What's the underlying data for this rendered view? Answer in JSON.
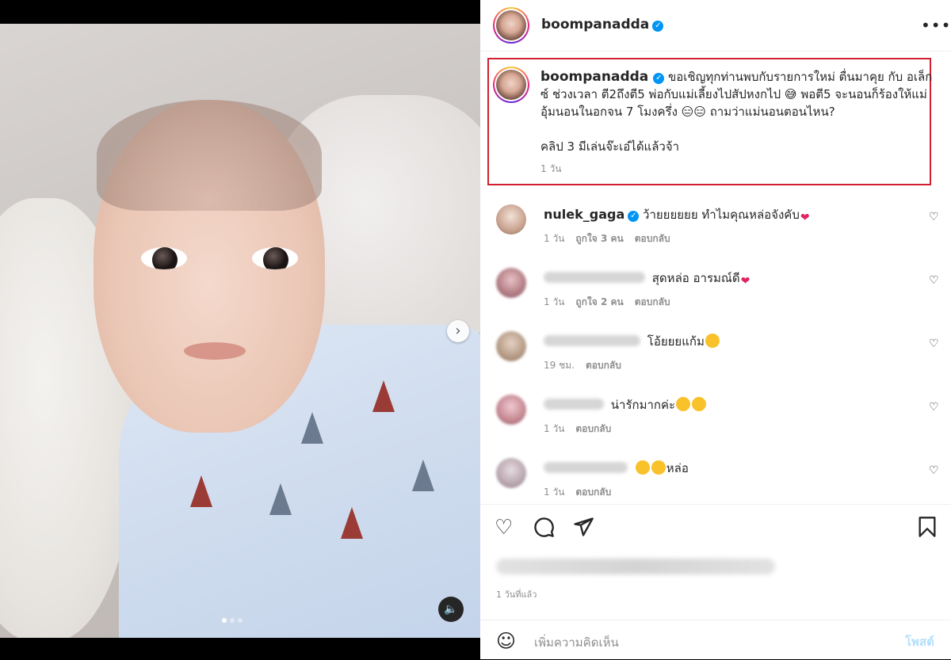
{
  "post": {
    "author": "boompanadda",
    "caption": "ขอเชิญทุกท่านพบกับรายการใหม่ ตื่นมาคุย กับ อเล็กซ์ ช่วงเวลา ตี2ถึงตี5 พ่อกับแม่เลี้ยงไปสัปหงกไป 😅 พอตี5 จะนอนก็ร้องให้แม่อุ้มนอนในอกจน 7 โมงครึ่ง 😑😑 ถามว่าแม่นอนตอนไหน?",
    "caption_line2": "คลิป 3 มีเล่นจ๊ะเอ๋ได้แล้วจ้า",
    "caption_time": "1 วัน",
    "time_ago": "1 วันที่แล้ว"
  },
  "comments": [
    {
      "user": "nulek_gaga",
      "verified": true,
      "text": "ว้ายยยยยย ทำไมคุณหล่อจังคับ",
      "time": "1 วัน",
      "likes": "ถูกใจ 3 คน",
      "reply": "ตอบกลับ"
    },
    {
      "user": "",
      "verified": false,
      "text": "สุดหล่อ อารมณ์ดี",
      "time": "1 วัน",
      "likes": "ถูกใจ 2 คน",
      "reply": "ตอบกลับ"
    },
    {
      "user": "",
      "verified": false,
      "text": "โอ้ยยยแก้ม",
      "time": "19 ชม.",
      "likes": "",
      "reply": "ตอบกลับ"
    },
    {
      "user": "",
      "verified": false,
      "text": "น่ารักมากค่ะ",
      "time": "1 วัน",
      "likes": "",
      "reply": "ตอบกลับ"
    },
    {
      "user": "",
      "verified": false,
      "text": "หล่อ",
      "time": "1 วัน",
      "likes": "",
      "reply": "ตอบกลับ"
    }
  ],
  "composer": {
    "placeholder": "เพิ่มความคิดเห็น",
    "post_label": "โพสต์"
  },
  "icons": {
    "more": "more-horizontal-icon",
    "like": "heart-icon",
    "comment": "comment-icon",
    "share": "send-icon",
    "save": "bookmark-icon",
    "emoji": "smile-icon",
    "next": "chevron-right-icon",
    "mute": "speaker-icon"
  },
  "colors": {
    "verified": "#0095f6",
    "highlight_border": "#d11f2f",
    "meta_text": "#8e8e8e",
    "post_button_disabled": "#b2dffc"
  },
  "carousel": {
    "slides": 3,
    "active": 1
  }
}
